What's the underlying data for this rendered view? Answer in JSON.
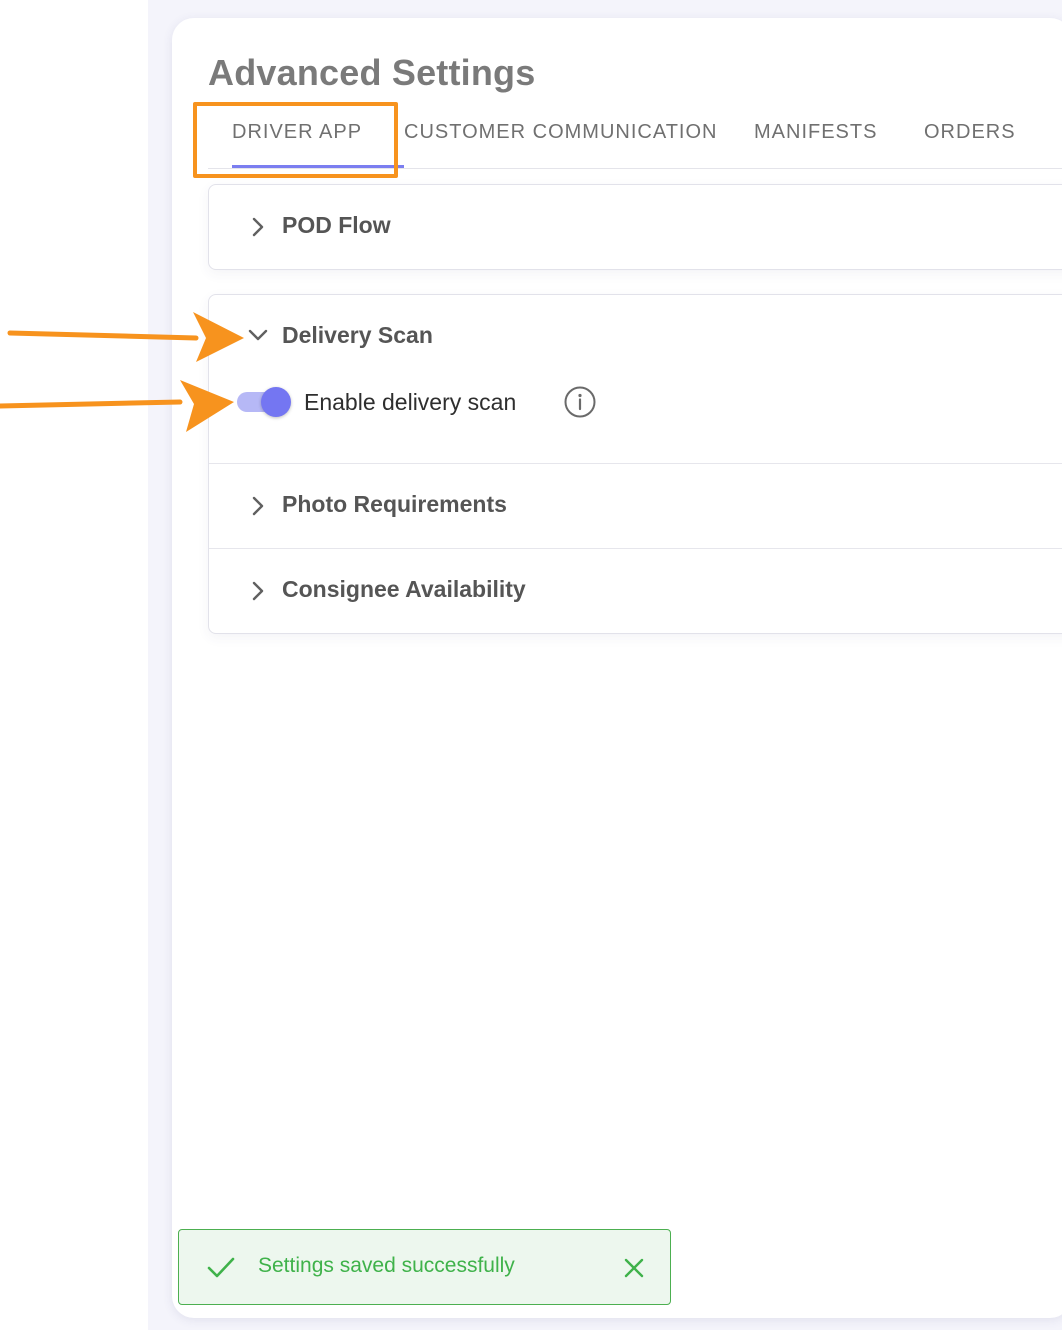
{
  "page": {
    "title": "Advanced Settings"
  },
  "tabs": [
    {
      "label": "DRIVER APP",
      "active": true
    },
    {
      "label": "CUSTOMER COMMUNICATION",
      "active": false
    },
    {
      "label": "MANIFESTS",
      "active": false
    },
    {
      "label": "ORDERS",
      "active": false
    }
  ],
  "sections": {
    "pod_flow": {
      "label": "POD Flow",
      "expanded": false,
      "icon": "chevron-right-icon"
    },
    "delivery_scan": {
      "label": "Delivery Scan",
      "expanded": true,
      "icon": "chevron-down-icon",
      "toggle": {
        "label": "Enable delivery scan",
        "enabled": true
      }
    },
    "photo_requirements": {
      "label": "Photo Requirements",
      "expanded": false,
      "icon": "chevron-right-icon"
    },
    "consignee_availability": {
      "label": "Consignee Availability",
      "expanded": false,
      "icon": "chevron-right-icon"
    }
  },
  "toast": {
    "message": "Settings saved successfully",
    "type": "success"
  },
  "colors": {
    "accent": "#7b7ef0",
    "highlight": "#f7931e",
    "success": "#3fb24a",
    "background": "#f4f4fb"
  }
}
